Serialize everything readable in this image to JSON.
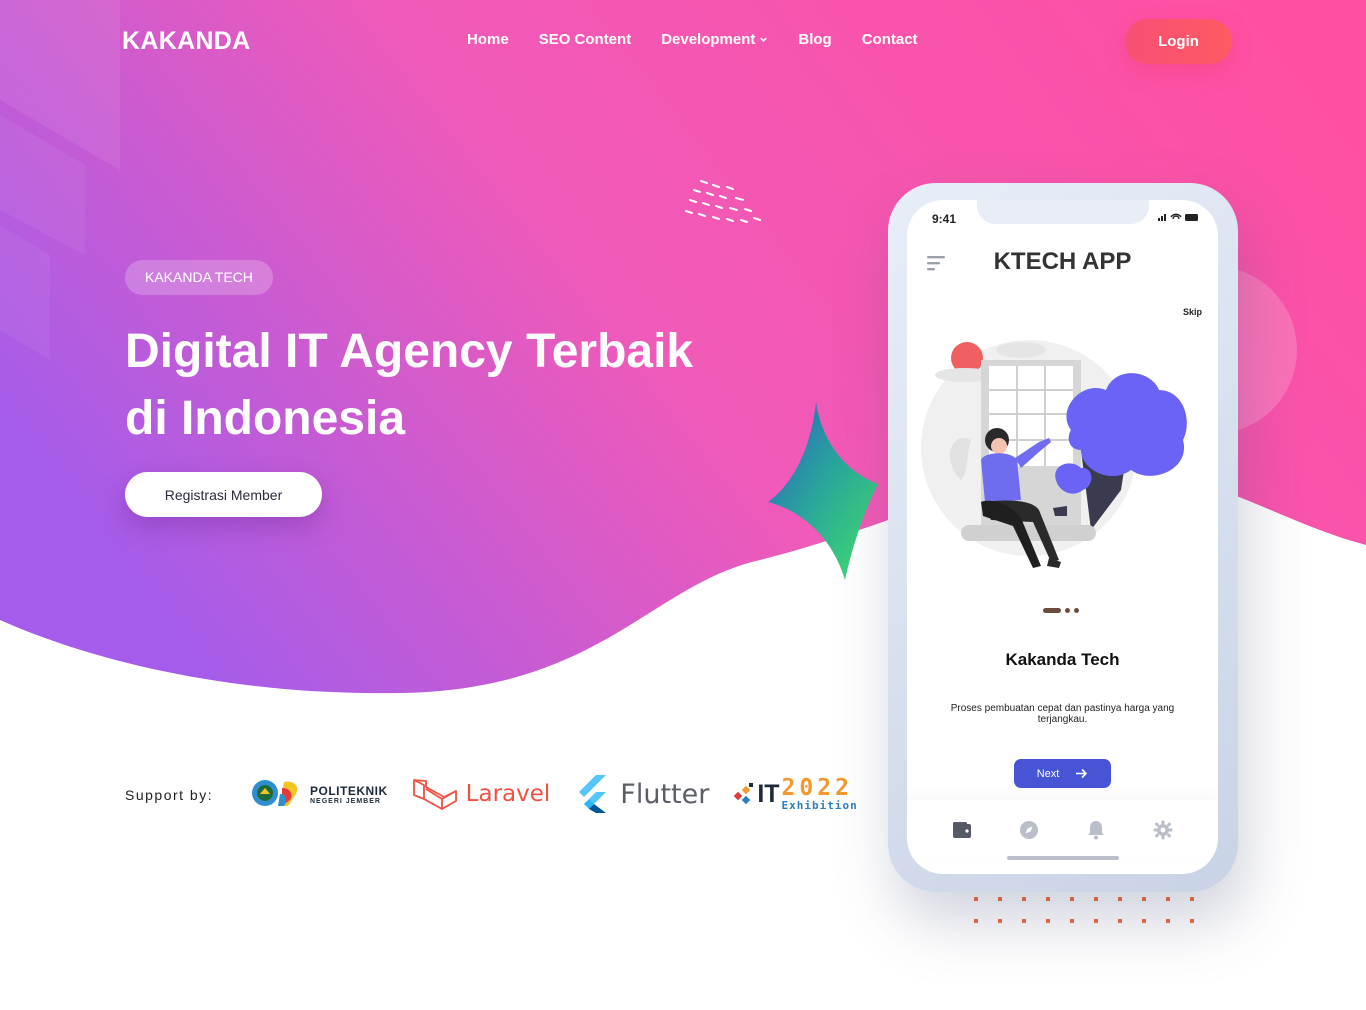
{
  "brand": {
    "name": "KAKANDA"
  },
  "nav": {
    "items": [
      "Home",
      "SEO Content",
      "Development",
      "Blog",
      "Contact"
    ],
    "login_label": "Login"
  },
  "hero": {
    "badge": "KAKANDA TECH",
    "headline_line1": "Digital IT Agency Terbaik",
    "headline_line2": "di Indonesia",
    "cta_label": "Registrasi Member"
  },
  "support": {
    "label": "Support by:",
    "logos": {
      "poli_line1": "POLITEKNIK",
      "poli_line2": "NEGERI JEMBER",
      "laravel": "Laravel",
      "flutter": "Flutter",
      "it": "IT",
      "it_year": "2022",
      "it_sub": "Exhibition"
    }
  },
  "phone": {
    "time": "9:41",
    "app_title": "KTECH APP",
    "skip": "Skip",
    "card_title": "Kakanda Tech",
    "card_desc": "Proses pembuatan cepat dan pastinya harga yang terjangkau.",
    "next_label": "Next",
    "tabs": [
      "wallet-icon",
      "compass-icon",
      "bell-icon",
      "gear-icon"
    ]
  },
  "colors": {
    "gradient_start": "#a55cea",
    "gradient_end": "#ff4fa3",
    "accent": "#4754d6",
    "login": "#f84f74"
  }
}
